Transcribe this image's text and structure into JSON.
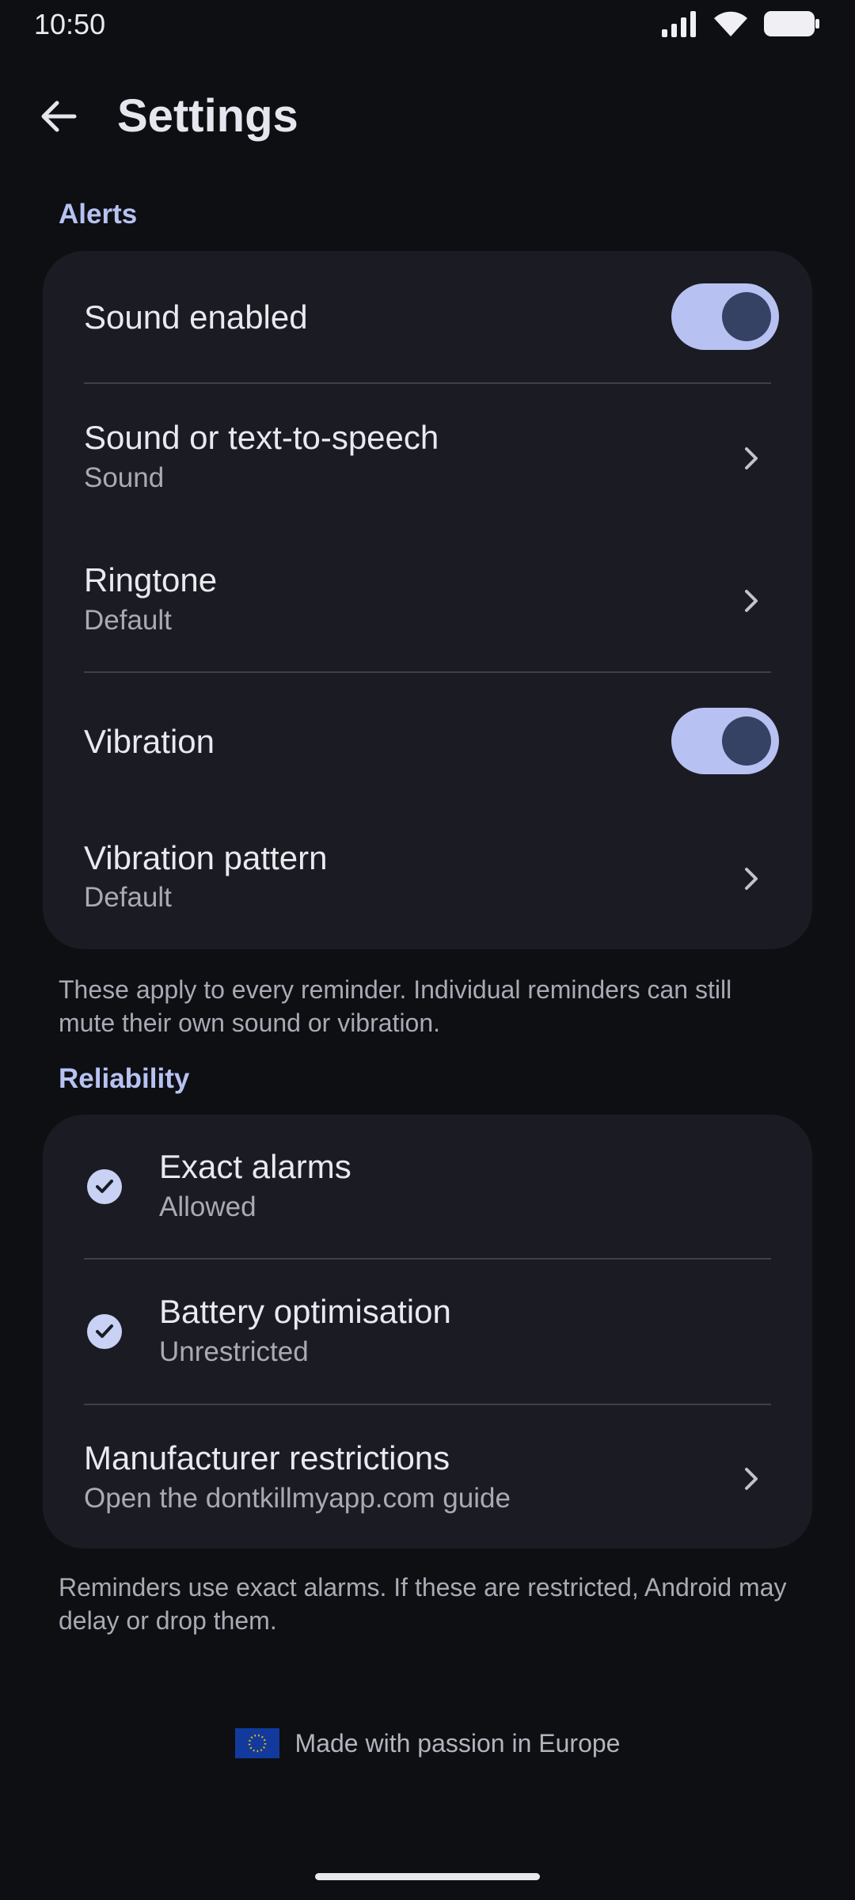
{
  "status_bar": {
    "time": "10:50"
  },
  "app_bar": {
    "title": "Settings"
  },
  "alerts": {
    "header": "Alerts",
    "sound_enabled": {
      "label": "Sound enabled",
      "on": true
    },
    "sound_or_tts": {
      "label": "Sound or text-to-speech",
      "value": "Sound"
    },
    "ringtone": {
      "label": "Ringtone",
      "value": "Default"
    },
    "vibration": {
      "label": "Vibration",
      "on": true
    },
    "vibration_pattern": {
      "label": "Vibration pattern",
      "value": "Default"
    },
    "footnote": "These apply to every reminder. Individual reminders can still mute their own sound or vibration."
  },
  "reliability": {
    "header": "Reliability",
    "exact_alarms": {
      "label": "Exact alarms",
      "value": "Allowed"
    },
    "battery_optimisation": {
      "label": "Battery optimisation",
      "value": "Unrestricted"
    },
    "manufacturer_restrictions": {
      "label": "Manufacturer restrictions",
      "value": "Open the dontkillmyapp.com guide"
    },
    "footnote": "Reminders use exact alarms. If these are restricted, Android may delay or drop them."
  },
  "footer": {
    "made_with": "Made with passion in Europe"
  },
  "colors": {
    "accent": "#b7c2f2",
    "card": "#1b1c23",
    "background": "#0e0f13"
  }
}
